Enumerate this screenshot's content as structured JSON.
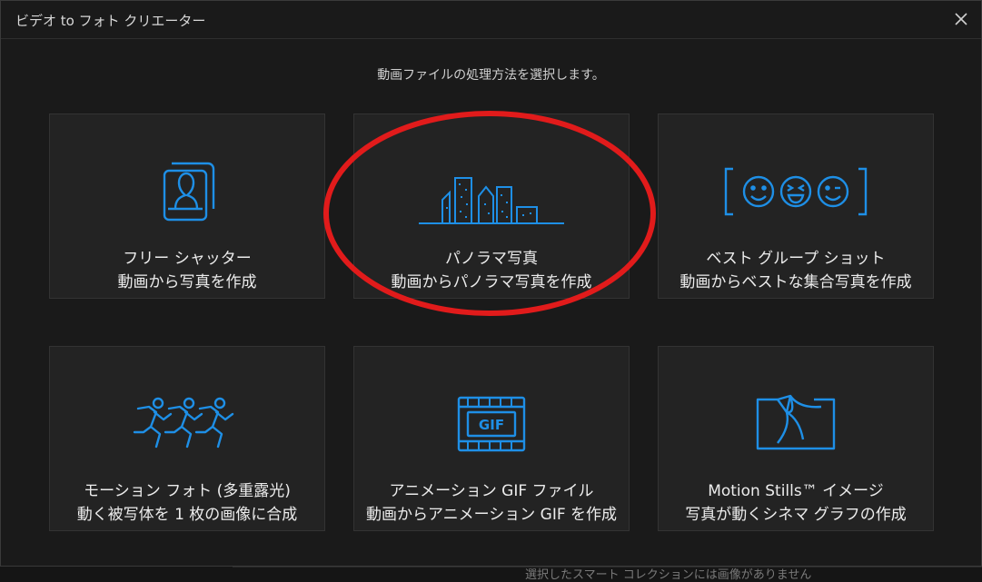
{
  "window": {
    "title": "ビデオ to フォト クリエーター",
    "close_icon": "close-icon"
  },
  "prompt": "動画ファイルの処理方法を選択します。",
  "accent_color": "#1e8fe6",
  "highlight_color": "#e11b1b",
  "options": [
    {
      "icon": "portrait-icon",
      "line1": "フリー シャッター",
      "line2": "動画から写真を作成"
    },
    {
      "icon": "city-skyline-icon",
      "line1": "パノラマ写真",
      "line2": "動画からパノラマ写真を作成"
    },
    {
      "icon": "smiley-faces-icon",
      "line1": "ベスト グループ ショット",
      "line2": "動画からベストな集合写真を作成"
    },
    {
      "icon": "running-figures-icon",
      "line1": "モーション フォト (多重露光)",
      "line2": "動く被写体を 1 枚の画像に合成"
    },
    {
      "icon": "gif-film-icon",
      "gif_text": "GIF",
      "line1": "アニメーション GIF ファイル",
      "line2": "動画からアニメーション GIF を作成"
    },
    {
      "icon": "kite-image-icon",
      "line1": "Motion Stills™ イメージ",
      "line2": "写真が動くシネマ グラフの作成"
    }
  ],
  "background_text": "選択したスマート コレクションには画像がありません"
}
